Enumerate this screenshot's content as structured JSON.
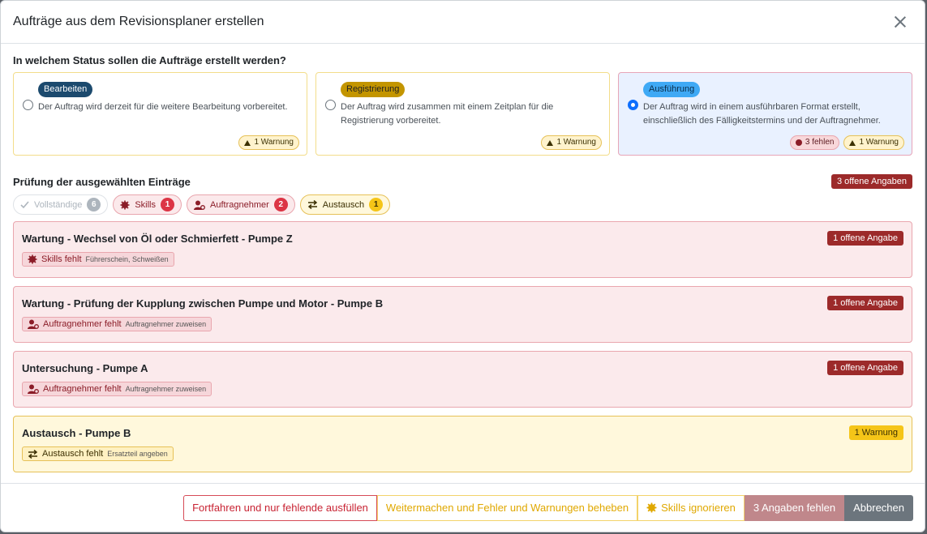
{
  "modal": {
    "title": "Aufträge aus dem Revisionsplaner erstellen"
  },
  "status": {
    "question": "In welchem Status sollen die Aufträge erstellt werden?",
    "cards": [
      {
        "label": "Bearbeiten",
        "desc": "Der Auftrag wird derzeit für die weitere Bearbeitung vorbereitet.",
        "warning": "1 Warnung"
      },
      {
        "label": "Registrierung",
        "desc": "Der Auftrag wird zusammen mit einem Zeitplan für die Registrierung vorbereitet.",
        "warning": "1 Warnung"
      },
      {
        "label": "Ausführung",
        "desc": "Der Auftrag wird in einem ausführbaren Format erstellt, einschließlich des Fälligkeitstermins und der Auftragnehmer.",
        "error": "3 fehlen",
        "warning": "1 Warnung"
      }
    ]
  },
  "review": {
    "title": "Prüfung der ausgewählten Einträge",
    "open_badge": "3 offene Angaben",
    "filters": [
      {
        "label": "Vollständige",
        "count": "6"
      },
      {
        "label": "Skills",
        "count": "1"
      },
      {
        "label": "Auftragnehmer",
        "count": "2"
      },
      {
        "label": "Austausch",
        "count": "1"
      }
    ],
    "entries": [
      {
        "title": "Wartung - Wechsel von Öl oder Schmierfett - Pumpe Z",
        "tag": "1 offene Angabe",
        "chip": "Skills fehlt",
        "chip_sub": "Führerschein, Schweißen"
      },
      {
        "title": "Wartung - Prüfung der Kupplung zwischen Pumpe und Motor - Pumpe B",
        "tag": "1 offene Angabe",
        "chip": "Auftragnehmer fehlt",
        "chip_sub": "Auftragnehmer zuweisen"
      },
      {
        "title": "Untersuchung - Pumpe A",
        "tag": "1 offene Angabe",
        "chip": "Auftragnehmer fehlt",
        "chip_sub": "Auftragnehmer zuweisen"
      },
      {
        "title": "Austausch - Pumpe B",
        "tag": "1 Warnung",
        "chip": "Austausch fehlt",
        "chip_sub": "Ersatzteil angeben"
      }
    ]
  },
  "footer": {
    "btn_fill_missing": "Fortfahren und nur fehlende ausfüllen",
    "btn_fix": "Weitermachen und Fehler und Warnungen beheben",
    "btn_ignore_skills": "Skills ignorieren",
    "btn_missing": "3 Angaben fehlen",
    "btn_cancel": "Abbrechen"
  }
}
